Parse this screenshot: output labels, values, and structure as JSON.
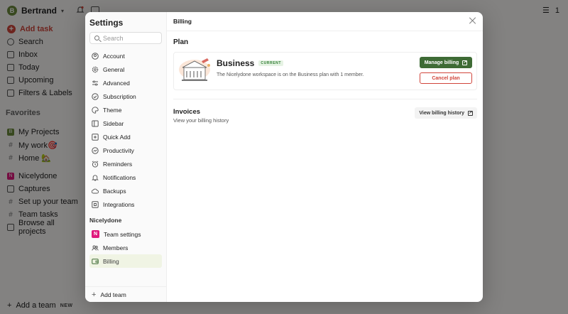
{
  "background": {
    "user_name": "Bertrand",
    "user_initial": "B",
    "notifications_count": "1",
    "add_task": "Add task",
    "nav": [
      "Search",
      "Inbox",
      "Today",
      "Upcoming",
      "Filters & Labels"
    ],
    "favorites_label": "Favorites",
    "favorites": [
      "My Projects",
      "My work🎯",
      "Home 🏡"
    ],
    "team_name": "Nicelydone",
    "team_projects": [
      "Captures",
      "Set up your team",
      "Team tasks",
      "Browse all projects"
    ],
    "add_team": "Add a team",
    "add_team_badge": "NEW"
  },
  "modal": {
    "sidebar": {
      "title": "Settings",
      "search_placeholder": "Search",
      "items": [
        {
          "label": "Account",
          "icon": "account-icon"
        },
        {
          "label": "General",
          "icon": "gear-icon"
        },
        {
          "label": "Advanced",
          "icon": "sliders-icon"
        },
        {
          "label": "Subscription",
          "icon": "subscription-icon"
        },
        {
          "label": "Theme",
          "icon": "palette-icon"
        },
        {
          "label": "Sidebar",
          "icon": "sidebar-icon"
        },
        {
          "label": "Quick Add",
          "icon": "quick-add-icon"
        },
        {
          "label": "Productivity",
          "icon": "productivity-icon"
        },
        {
          "label": "Reminders",
          "icon": "alarm-icon"
        },
        {
          "label": "Notifications",
          "icon": "bell-icon"
        },
        {
          "label": "Backups",
          "icon": "cloud-icon"
        },
        {
          "label": "Integrations",
          "icon": "integrations-icon"
        }
      ],
      "team_group_label": "Nicelydone",
      "team_badge": "N",
      "team_items": [
        {
          "label": "Team settings"
        },
        {
          "label": "Members"
        },
        {
          "label": "Billing"
        }
      ],
      "add_team": "Add team"
    },
    "header": {
      "title": "Billing"
    },
    "plan": {
      "section_title": "Plan",
      "name": "Business",
      "badge": "CURRENT",
      "description": "The Nicelydone workspace is on the Business plan with 1 member.",
      "manage_label": "Manage billing",
      "cancel_label": "Cancel plan"
    },
    "invoices": {
      "title": "Invoices",
      "subtitle": "View your billing history",
      "button_label": "View billing history"
    },
    "colors": {
      "primary_green": "#3e6b35",
      "cancel_red": "#d1453b",
      "active_bg": "#f0f4e4",
      "team_badge": "#e0197d"
    }
  }
}
